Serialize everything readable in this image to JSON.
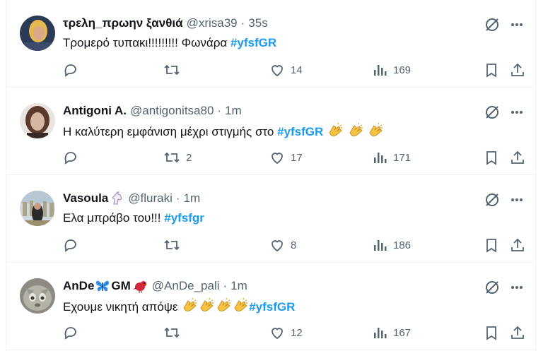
{
  "tweets": [
    {
      "name": "τρελη_πρωην ξανθιά",
      "handle": "@xrisa39",
      "separator": "·",
      "time": "35s",
      "text": "Τρομερό τυπακι!!!!!!!!! Φωνάρα ",
      "hashtag": "#yfsfGR",
      "claps": 0,
      "replies": "",
      "retweets": "",
      "likes": "14",
      "views": "169",
      "avatar_colors": [
        "#2b3a55",
        "#e5b94e"
      ]
    },
    {
      "name": "Antigoni A.",
      "handle": "@antigonitsa80",
      "separator": "·",
      "time": "1m",
      "text": "Η καλύτερη εμφάνιση μέχρι στιγμής στο ",
      "hashtag": "#yfsfGR",
      "claps": 3,
      "replies": "",
      "retweets": "2",
      "likes": "17",
      "views": "171",
      "avatar_colors": [
        "#5a3b2e",
        "#d8b7a2"
      ]
    },
    {
      "name": "Vasoula",
      "handle": "@fluraki",
      "separator": "·",
      "time": "1m",
      "text": "Ελα μπράβο του!!! ",
      "hashtag": "#yfsfgr",
      "claps": 0,
      "replies": "",
      "retweets": "",
      "likes": "8",
      "views": "186",
      "avatar_colors": [
        "#a9a38a",
        "#2b2b2b"
      ]
    },
    {
      "name": "AnDe",
      "name_suffix": "GM",
      "handle": "@AnDe_pali",
      "separator": "·",
      "time": "1m",
      "text": "Εχουμε νικητή απόψε ",
      "hashtag": "#yfsfGR",
      "claps": 4,
      "replies": "",
      "retweets": "",
      "likes": "12",
      "views": "167",
      "avatar_colors": [
        "#9a9a92",
        "#6f6b62"
      ]
    }
  ],
  "colors": {
    "hashtag": "#1d9bf0",
    "muted": "#536471",
    "text": "#0f1419"
  },
  "icons": [
    "reply-icon",
    "retweet-icon",
    "like-icon",
    "views-icon",
    "bookmark-icon",
    "share-icon",
    "grok-icon",
    "more-icon"
  ]
}
